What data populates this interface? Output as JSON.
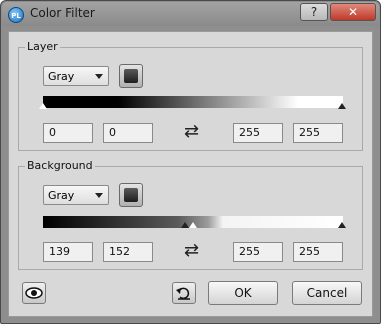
{
  "window": {
    "title": "Color Filter",
    "app_icon_text": "PL",
    "help_label": "?",
    "close_label": "✕"
  },
  "layer": {
    "label": "Layer",
    "mode": "Gray",
    "fields": [
      "0",
      "0",
      "255",
      "255"
    ]
  },
  "background": {
    "label": "Background",
    "mode": "Gray",
    "fields": [
      "139",
      "152",
      "255",
      "255"
    ]
  },
  "footer": {
    "ok_label": "OK",
    "cancel_label": "Cancel"
  }
}
